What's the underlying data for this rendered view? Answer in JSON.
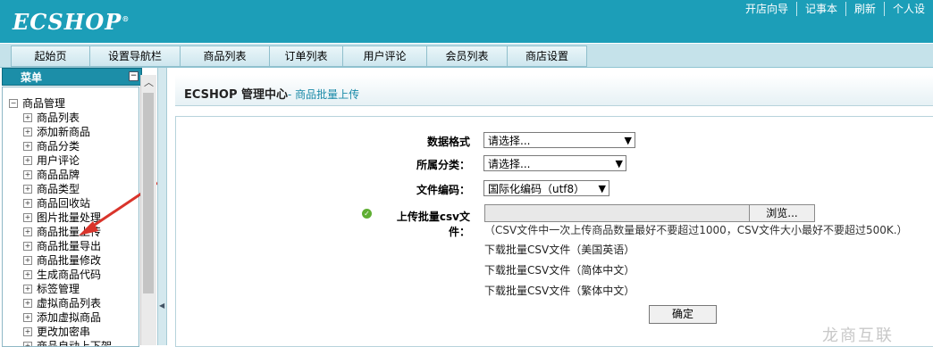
{
  "header": {
    "logo": "ECSHOP",
    "links": [
      "开店向导",
      "记事本",
      "刷新",
      "个人设"
    ]
  },
  "nav": {
    "tabs": [
      "起始页",
      "设置导航栏",
      "商品列表",
      "订单列表",
      "用户评论",
      "会员列表",
      "商店设置"
    ]
  },
  "menu": {
    "title": "菜单",
    "collapse_glyph": "−",
    "group": "商品管理",
    "items": [
      "商品列表",
      "添加新商品",
      "商品分类",
      "用户评论",
      "商品品牌",
      "商品类型",
      "商品回收站",
      "图片批量处理",
      "商品批量上传",
      "商品批量导出",
      "商品批量修改",
      "生成商品代码",
      "标签管理",
      "虚拟商品列表",
      "添加虚拟商品",
      "更改加密串",
      "商品自动上下架"
    ]
  },
  "main": {
    "title": "ECSHOP 管理中心",
    "subtitle": "- 商品批量上传",
    "form": {
      "format_label": "数据格式",
      "format_value": "请选择...",
      "category_label": "所属分类：",
      "category_value": "请选择...",
      "encoding_label": "文件编码：",
      "encoding_value": "国际化编码（utf8）",
      "upload_label": "上传批量csv文件：",
      "browse_label": "浏览...",
      "note": "（CSV文件中一次上传商品数量最好不要超过1000，CSV文件大小最好不要超过500K.）",
      "downloads": [
        "下载批量CSV文件（美国英语）",
        "下载批量CSV文件（简体中文）",
        "下载批量CSV文件（繁体中文）"
      ],
      "submit_label": "确定"
    }
  },
  "watermark": "龙商互联",
  "colors": {
    "header_bg": "#1c9eb8",
    "accent": "#1a8aa8",
    "annotation_arrow": "#d9342b"
  }
}
